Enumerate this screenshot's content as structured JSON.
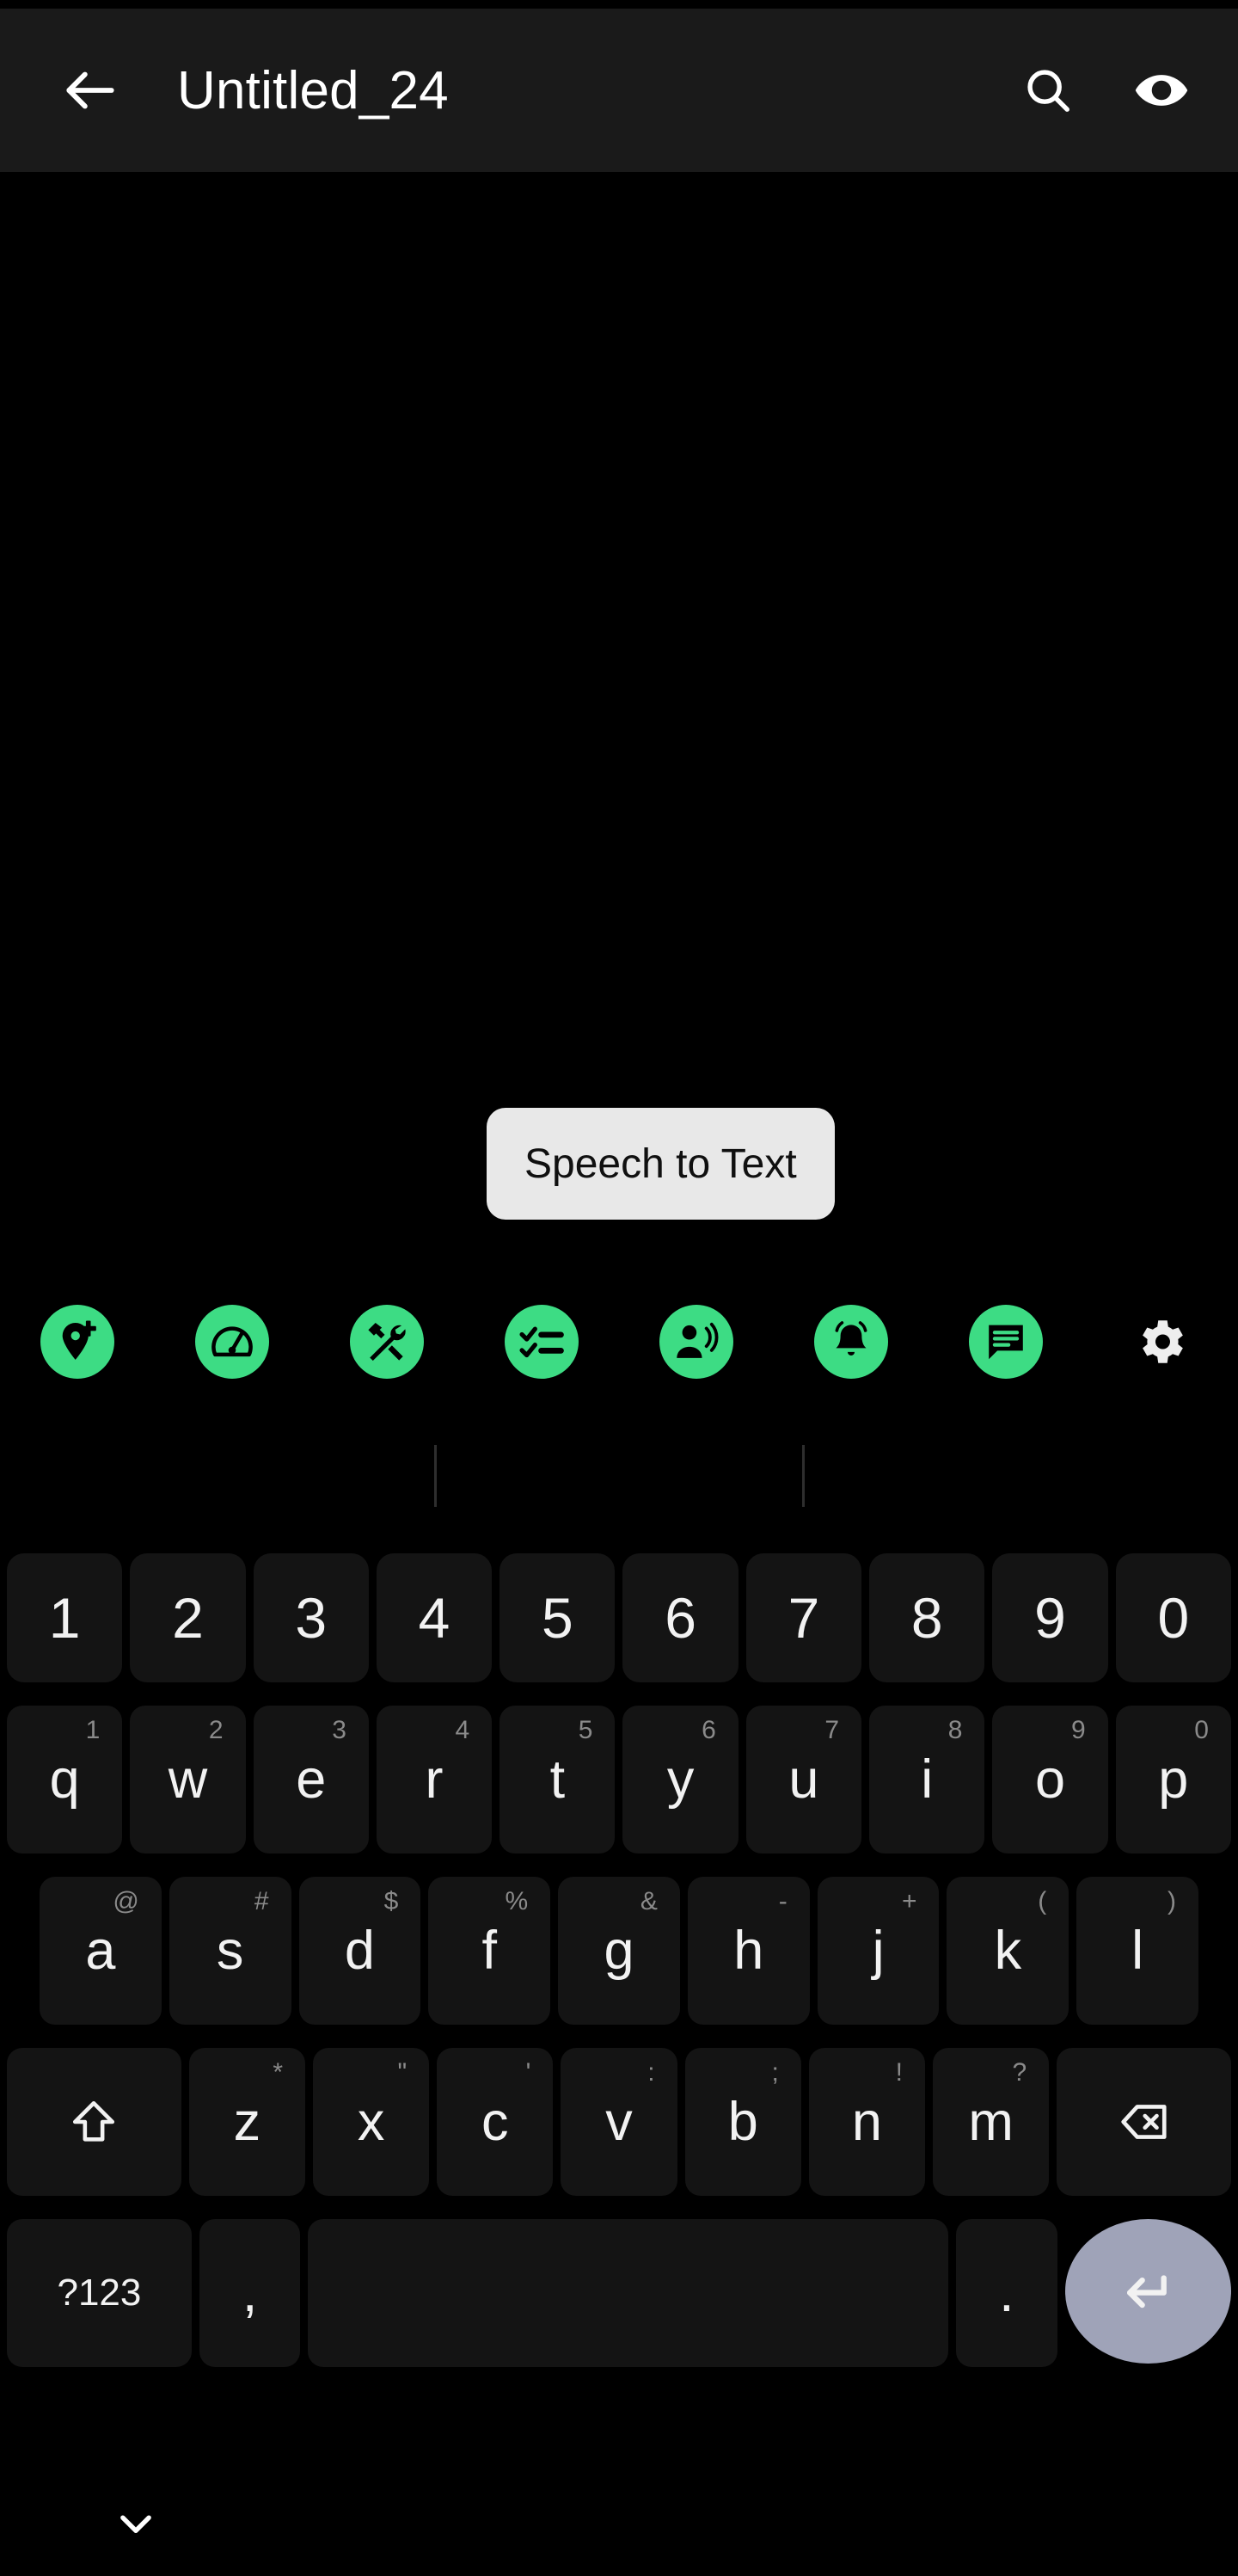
{
  "app_bar": {
    "back_icon": "arrow-back-icon",
    "title": "Untitled_24",
    "search_icon": "search-icon",
    "visibility_icon": "eye-icon"
  },
  "editor": {
    "content": ""
  },
  "tooltip": {
    "label": "Speech to Text",
    "background": "#e8e8e8",
    "text_color": "#101010"
  },
  "toolbar": {
    "accent_color": "#3ddc84",
    "items": [
      {
        "icon": "add-location-icon",
        "label": "Add Location"
      },
      {
        "icon": "speedometer-icon",
        "label": "Speed"
      },
      {
        "icon": "tools-icon",
        "label": "Tools"
      },
      {
        "icon": "checklist-icon",
        "label": "Checklist"
      },
      {
        "icon": "voice-record-icon",
        "label": "Voice"
      },
      {
        "icon": "alarm-bell-icon",
        "label": "Reminder"
      },
      {
        "icon": "comment-icon",
        "label": "Comment"
      },
      {
        "icon": "gear-icon",
        "label": "Settings"
      }
    ]
  },
  "suggestion_strip": {
    "suggestions": [
      "",
      "",
      ""
    ]
  },
  "keyboard": {
    "key_background": "#141414",
    "key_text_color": "#f2f2f2",
    "alt_text_color": "#8a8a8a",
    "enter_background": "#9fa3b8",
    "rows": {
      "numbers": [
        {
          "main": "1"
        },
        {
          "main": "2"
        },
        {
          "main": "3"
        },
        {
          "main": "4"
        },
        {
          "main": "5"
        },
        {
          "main": "6"
        },
        {
          "main": "7"
        },
        {
          "main": "8"
        },
        {
          "main": "9"
        },
        {
          "main": "0"
        }
      ],
      "letters_1": [
        {
          "main": "q",
          "alt": "1"
        },
        {
          "main": "w",
          "alt": "2"
        },
        {
          "main": "e",
          "alt": "3"
        },
        {
          "main": "r",
          "alt": "4"
        },
        {
          "main": "t",
          "alt": "5"
        },
        {
          "main": "y",
          "alt": "6"
        },
        {
          "main": "u",
          "alt": "7"
        },
        {
          "main": "i",
          "alt": "8"
        },
        {
          "main": "o",
          "alt": "9"
        },
        {
          "main": "p",
          "alt": "0"
        }
      ],
      "letters_2": [
        {
          "main": "a",
          "alt": "@"
        },
        {
          "main": "s",
          "alt": "#"
        },
        {
          "main": "d",
          "alt": "$"
        },
        {
          "main": "f",
          "alt": "%"
        },
        {
          "main": "g",
          "alt": "&"
        },
        {
          "main": "h",
          "alt": "-"
        },
        {
          "main": "j",
          "alt": "+"
        },
        {
          "main": "k",
          "alt": "("
        },
        {
          "main": "l",
          "alt": ")"
        }
      ],
      "letters_3": [
        {
          "main": "z",
          "alt": "*"
        },
        {
          "main": "x",
          "alt": "\""
        },
        {
          "main": "c",
          "alt": "'"
        },
        {
          "main": "v",
          "alt": ":"
        },
        {
          "main": "b",
          "alt": ";"
        },
        {
          "main": "n",
          "alt": "!"
        },
        {
          "main": "m",
          "alt": "?"
        }
      ],
      "shift_icon": "shift-icon",
      "backspace_icon": "backspace-icon",
      "bottom": {
        "symbols_label": "?123",
        "comma_label": ",",
        "space_label": "",
        "period_label": ".",
        "enter_icon": "enter-icon"
      }
    }
  },
  "bottom_bar": {
    "hide_keyboard_icon": "chevron-down-icon"
  }
}
